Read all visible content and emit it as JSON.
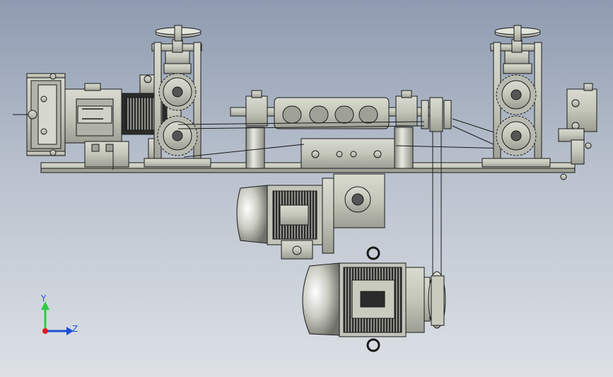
{
  "triad": {
    "y_label": "Y",
    "z_label": "Z",
    "x_color": "#e01b1b",
    "y_color": "#2ecc40",
    "z_color": "#1f4fd8"
  },
  "colors": {
    "background_top": "#8e9bb0",
    "background_bottom": "#dde1e6",
    "part_fill": "#c9cbbf",
    "part_shade": "#9fa196",
    "edge": "#1a1a1a"
  }
}
